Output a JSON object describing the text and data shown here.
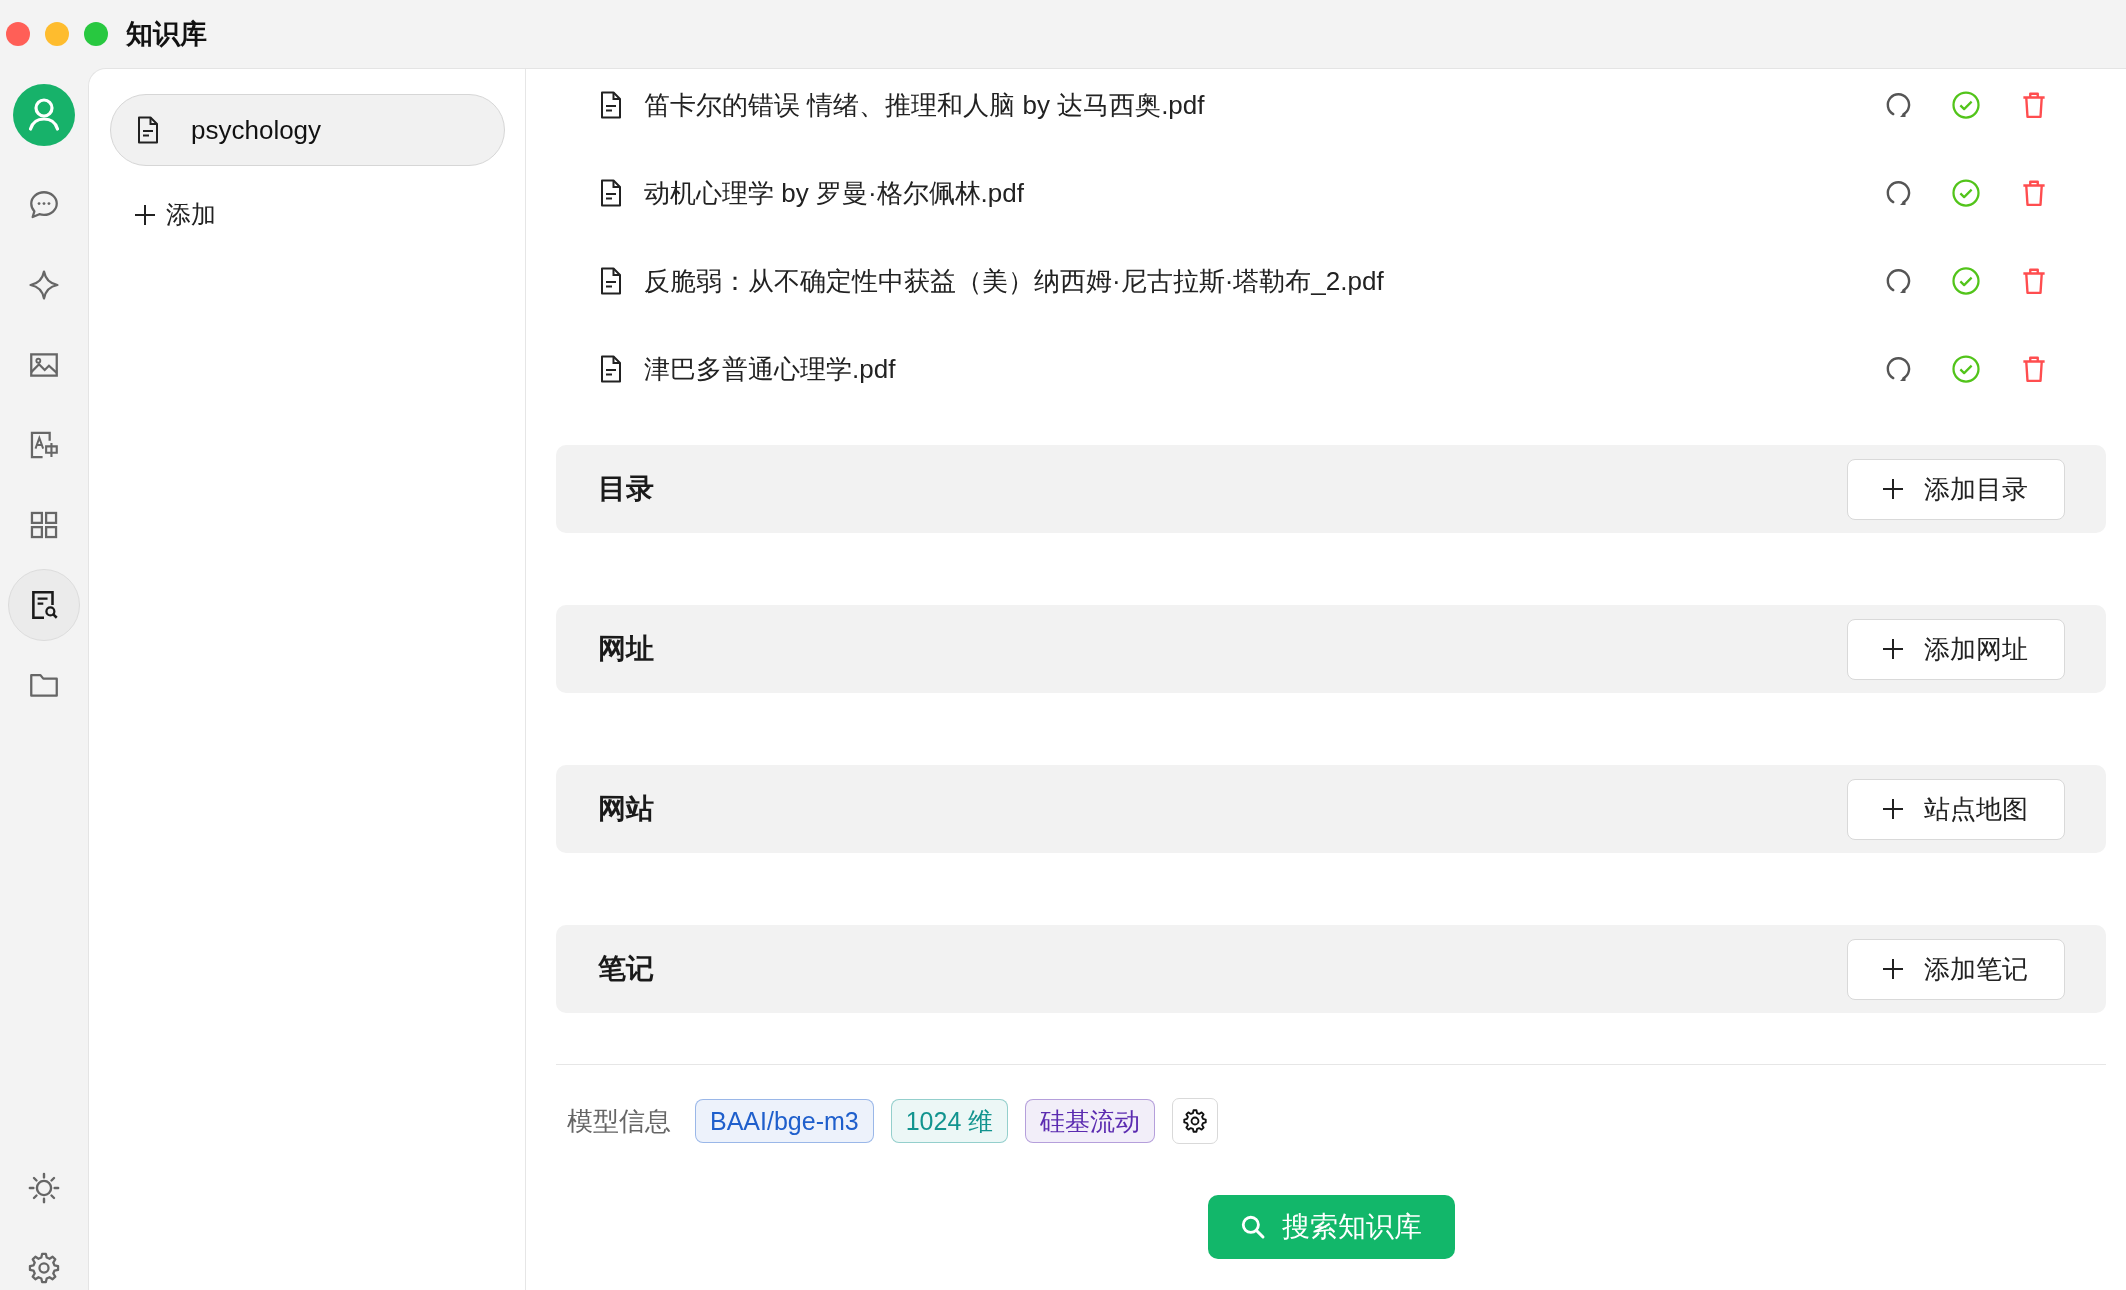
{
  "window": {
    "title": "知识库"
  },
  "nav": {
    "top": [
      {
        "kind": "chat",
        "selected": false
      },
      {
        "kind": "assistant",
        "selected": false
      },
      {
        "kind": "image",
        "selected": false
      },
      {
        "kind": "translate",
        "selected": false
      },
      {
        "kind": "apps",
        "selected": false
      },
      {
        "kind": "knowledge",
        "selected": true
      },
      {
        "kind": "files",
        "selected": false
      }
    ],
    "bottom": [
      {
        "kind": "theme"
      },
      {
        "kind": "settings"
      }
    ]
  },
  "sidebar": {
    "items": [
      {
        "label": "psychology",
        "selected": true
      }
    ],
    "add_label": "添加"
  },
  "files": [
    {
      "name": "笛卡尔的错误 情绪、推理和人脑 by 达马西奥.pdf",
      "processed": true
    },
    {
      "name": "动机心理学 by 罗曼·格尔佩林.pdf",
      "processed": true
    },
    {
      "name": "反脆弱：从不确定性中获益（美）纳西姆·尼古拉斯·塔勒布_2.pdf",
      "processed": true
    },
    {
      "name": "津巴多普通心理学.pdf",
      "processed": true
    }
  ],
  "sections": [
    {
      "title": "目录",
      "button": "添加目录"
    },
    {
      "title": "网址",
      "button": "添加网址"
    },
    {
      "title": "网站",
      "button": "站点地图"
    },
    {
      "title": "笔记",
      "button": "添加笔记"
    }
  ],
  "model_info": {
    "label": "模型信息",
    "tags": [
      {
        "text": "BAAI/bge-m3",
        "color": "#1f5fcc"
      },
      {
        "text": "1024 维",
        "color": "#12948f"
      },
      {
        "text": "硅基流动",
        "color": "#5b2bb0"
      }
    ]
  },
  "search_button": "搜索知识库"
}
